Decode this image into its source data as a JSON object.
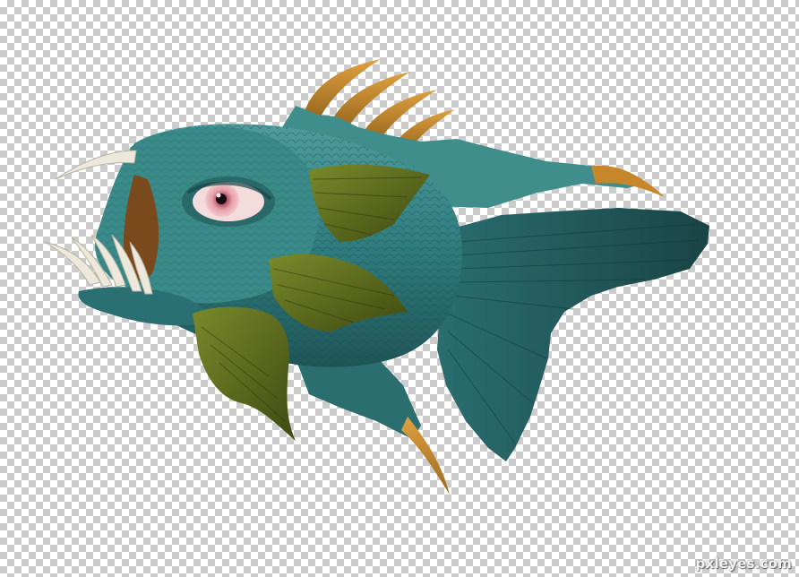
{
  "canvas": {
    "background": "transparency-checkerboard",
    "checker_light": "#ffffff",
    "checker_dark": "#cccccc"
  },
  "artwork": {
    "subject": "fish-monster",
    "colors": {
      "body": "#2f7d7f",
      "body_dark": "#1f4f52",
      "body_light": "#5fa8a6",
      "fins_green": "#5a6b1c",
      "fins_green_light": "#7a8a2a",
      "spines_orange": "#d08a2a",
      "teeth": "#ece8dc",
      "eye_pink": "#d98a95",
      "mouth_brown": "#7a4a1c"
    }
  },
  "watermark": {
    "text": "pxleyes.com"
  }
}
